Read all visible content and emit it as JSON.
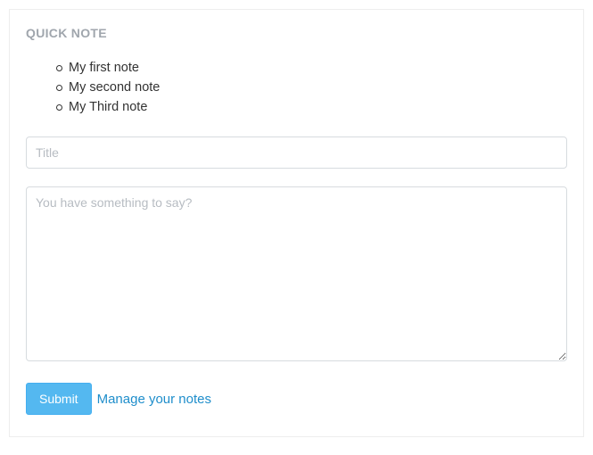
{
  "panel": {
    "title": "QUICK NOTE"
  },
  "notes": [
    {
      "title": "My first note"
    },
    {
      "title": "My second note"
    },
    {
      "title": "My Third note"
    }
  ],
  "form": {
    "title_placeholder": "Title",
    "title_value": "",
    "body_placeholder": "You have something to say?",
    "body_value": "",
    "submit_label": "Submit",
    "manage_link_label": "Manage your notes"
  },
  "colors": {
    "accent": "#54b8f0",
    "link": "#1f8ecb",
    "muted_heading": "#a0a6ad",
    "border": "#d7dbdf"
  }
}
